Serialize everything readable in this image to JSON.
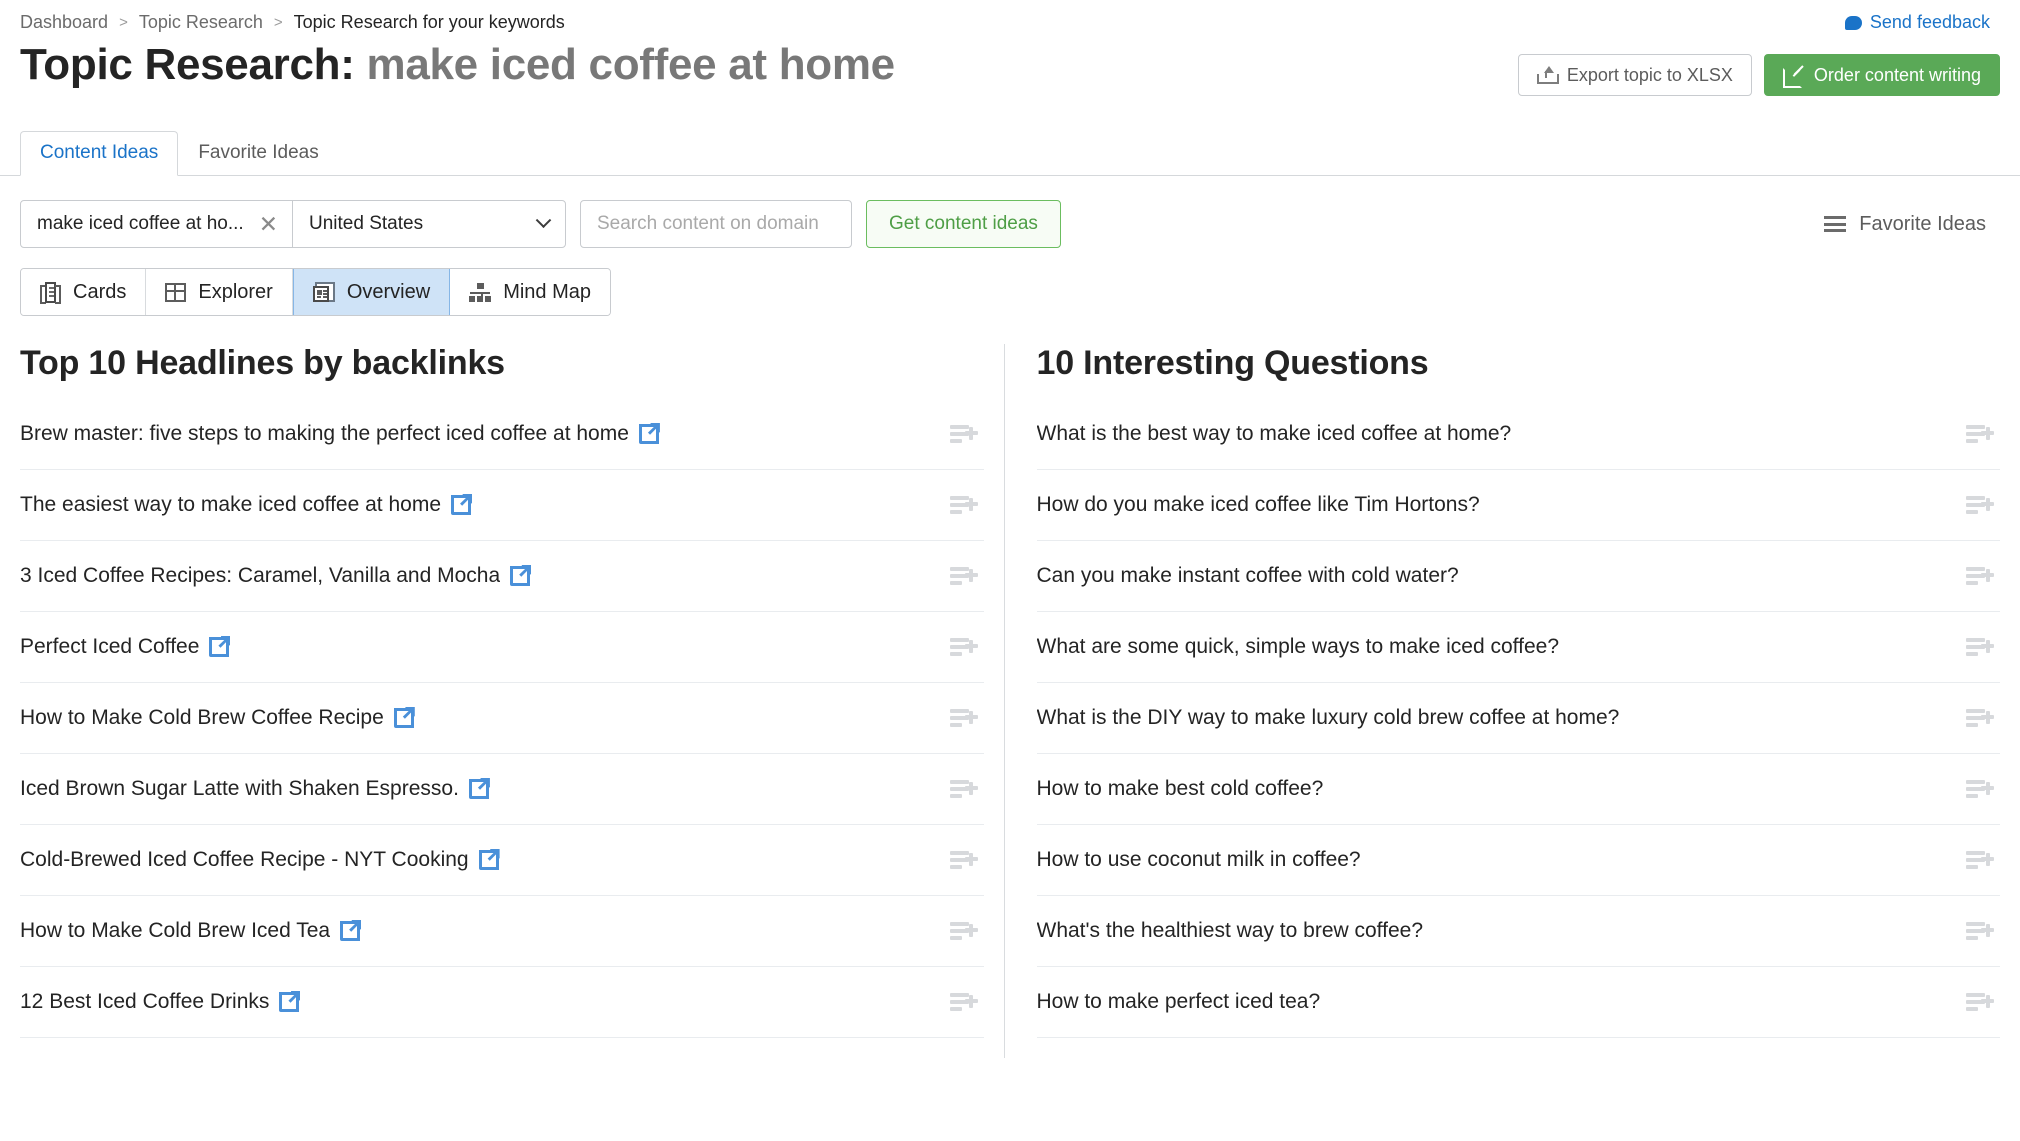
{
  "breadcrumb": {
    "items": [
      "Dashboard",
      "Topic Research",
      "Topic Research for your keywords"
    ],
    "separator": ">"
  },
  "feedback": {
    "label": "Send feedback",
    "icon": "speech-bubble-icon",
    "color": "#1a73c8"
  },
  "header": {
    "title_prefix": "Topic Research:",
    "title_keyword": "make iced coffee at home",
    "export_label": "Export topic to XLSX",
    "export_icon": "upload-icon",
    "order_label": "Order content writing",
    "order_icon": "edit-square-icon",
    "order_color": "#5aa957"
  },
  "tabs": [
    {
      "label": "Content Ideas",
      "active": true
    },
    {
      "label": "Favorite Ideas",
      "active": false
    }
  ],
  "filters": {
    "keyword_value": "make iced coffee at ho...",
    "keyword_clear_icon": "close-icon",
    "country_value": "United States",
    "country_chevron_icon": "chevron-down-icon",
    "domain_placeholder": "Search content on domain",
    "domain_value": "",
    "get_ideas_label": "Get content ideas",
    "favorite_ideas_label": "Favorite Ideas",
    "favorite_ideas_icon": "list-icon"
  },
  "views": [
    {
      "label": "Cards",
      "icon": "cards-icon",
      "active": false
    },
    {
      "label": "Explorer",
      "icon": "table-icon",
      "active": false
    },
    {
      "label": "Overview",
      "icon": "overview-icon",
      "active": true
    },
    {
      "label": "Mind Map",
      "icon": "mindmap-icon",
      "active": false
    }
  ],
  "headlines": {
    "title": "Top 10 Headlines by backlinks",
    "items": [
      "Brew master: five steps to making the perfect iced coffee at home",
      "The easiest way to make iced coffee at home",
      "3 Iced Coffee Recipes: Caramel, Vanilla and Mocha",
      "Perfect Iced Coffee",
      "How to Make Cold Brew Coffee Recipe",
      "Iced Brown Sugar Latte with Shaken Espresso.",
      "Cold-Brewed Iced Coffee Recipe - NYT Cooking",
      "How to Make Cold Brew Iced Tea",
      "12 Best Iced Coffee Drinks"
    ],
    "external_icon": "external-link-icon",
    "add_icon": "add-to-list-icon"
  },
  "questions": {
    "title": "10 Interesting Questions",
    "items": [
      "What is the best way to make iced coffee at home?",
      "How do you make iced coffee like Tim Hortons?",
      "Can you make instant coffee with cold water?",
      "What are some quick, simple ways to make iced coffee?",
      "What is the DIY way to make luxury cold brew coffee at home?",
      "How to make best cold coffee?",
      "How to use coconut milk in coffee?",
      "What's the healthiest way to brew coffee?",
      "How to make perfect iced tea?"
    ],
    "add_icon": "add-to-list-icon"
  }
}
